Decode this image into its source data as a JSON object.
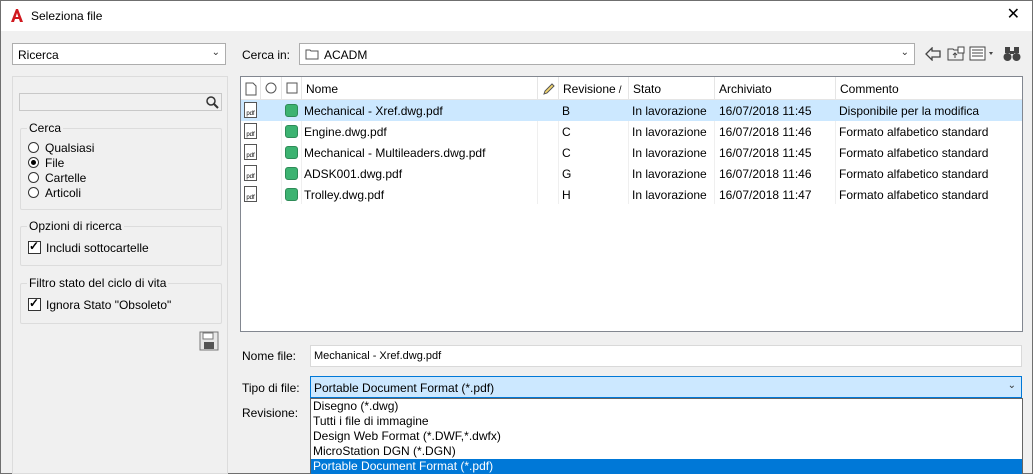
{
  "window": {
    "title": "Seleziona file",
    "close_label": "✕"
  },
  "left": {
    "mode_select": "Ricerca",
    "search_placeholder": "",
    "cerca": {
      "label": "Cerca",
      "options": [
        "Qualsiasi",
        "File",
        "Cartelle",
        "Articoli"
      ],
      "selected": "File"
    },
    "opzioni": {
      "label": "Opzioni di ricerca",
      "include_label": "Includi sottocartelle"
    },
    "filtro": {
      "label": "Filtro stato del ciclo di vita",
      "ignore_label": "Ignora Stato \"Obsoleto\""
    }
  },
  "top": {
    "look_in_label": "Cerca in:",
    "look_in_value": "ACADM"
  },
  "table": {
    "headers": {
      "nome": "Nome",
      "revisione": "Revisione",
      "stato": "Stato",
      "archiviato": "Archiviato",
      "commento": "Commento"
    },
    "rows": [
      {
        "nome": "Mechanical - Xref.dwg.pdf",
        "revisione": "B",
        "stato": "In lavorazione",
        "archiviato": "16/07/2018 11:45",
        "commento": "Disponibile per la modifica"
      },
      {
        "nome": "Engine.dwg.pdf",
        "revisione": "C",
        "stato": "In lavorazione",
        "archiviato": "16/07/2018 11:46",
        "commento": "Formato alfabetico standard"
      },
      {
        "nome": "Mechanical - Multileaders.dwg.pdf",
        "revisione": "C",
        "stato": "In lavorazione",
        "archiviato": "16/07/2018 11:45",
        "commento": "Formato alfabetico standard"
      },
      {
        "nome": "ADSK001.dwg.pdf",
        "revisione": "G",
        "stato": "In lavorazione",
        "archiviato": "16/07/2018 11:46",
        "commento": "Formato alfabetico standard"
      },
      {
        "nome": "Trolley.dwg.pdf",
        "revisione": "H",
        "stato": "In lavorazione",
        "archiviato": "16/07/2018 11:47",
        "commento": "Formato alfabetico standard"
      }
    ],
    "selected_row": 0
  },
  "bottom": {
    "filename_label": "Nome file:",
    "filename_value": "Mechanical - Xref.dwg.pdf",
    "filetype_label": "Tipo di file:",
    "filetype_value": "Portable Document Format (*.pdf)",
    "revision_label": "Revisione:",
    "filetype_options": [
      "Disegno (*.dwg)",
      "Tutti i file di immagine",
      "Design Web Format (*.DWF,*.dwfx)",
      "MicroStation DGN (*.DGN)",
      "Portable Document Format (*.pdf)"
    ]
  },
  "icons": {
    "app": "autocad-logo-icon",
    "folder": "folder-icon",
    "back": "back-arrow-icon",
    "up": "up-folder-icon",
    "views": "views-icon",
    "binoculars": "binoculars-icon",
    "search": "search-icon",
    "save": "save-icon",
    "pdf": "pdf-file-icon",
    "status": "lifecycle-status-icon"
  },
  "colors": {
    "selection": "#cce8ff",
    "accent": "#0078d7",
    "status_green": "#3cb371",
    "logo_red": "#d0191f"
  }
}
